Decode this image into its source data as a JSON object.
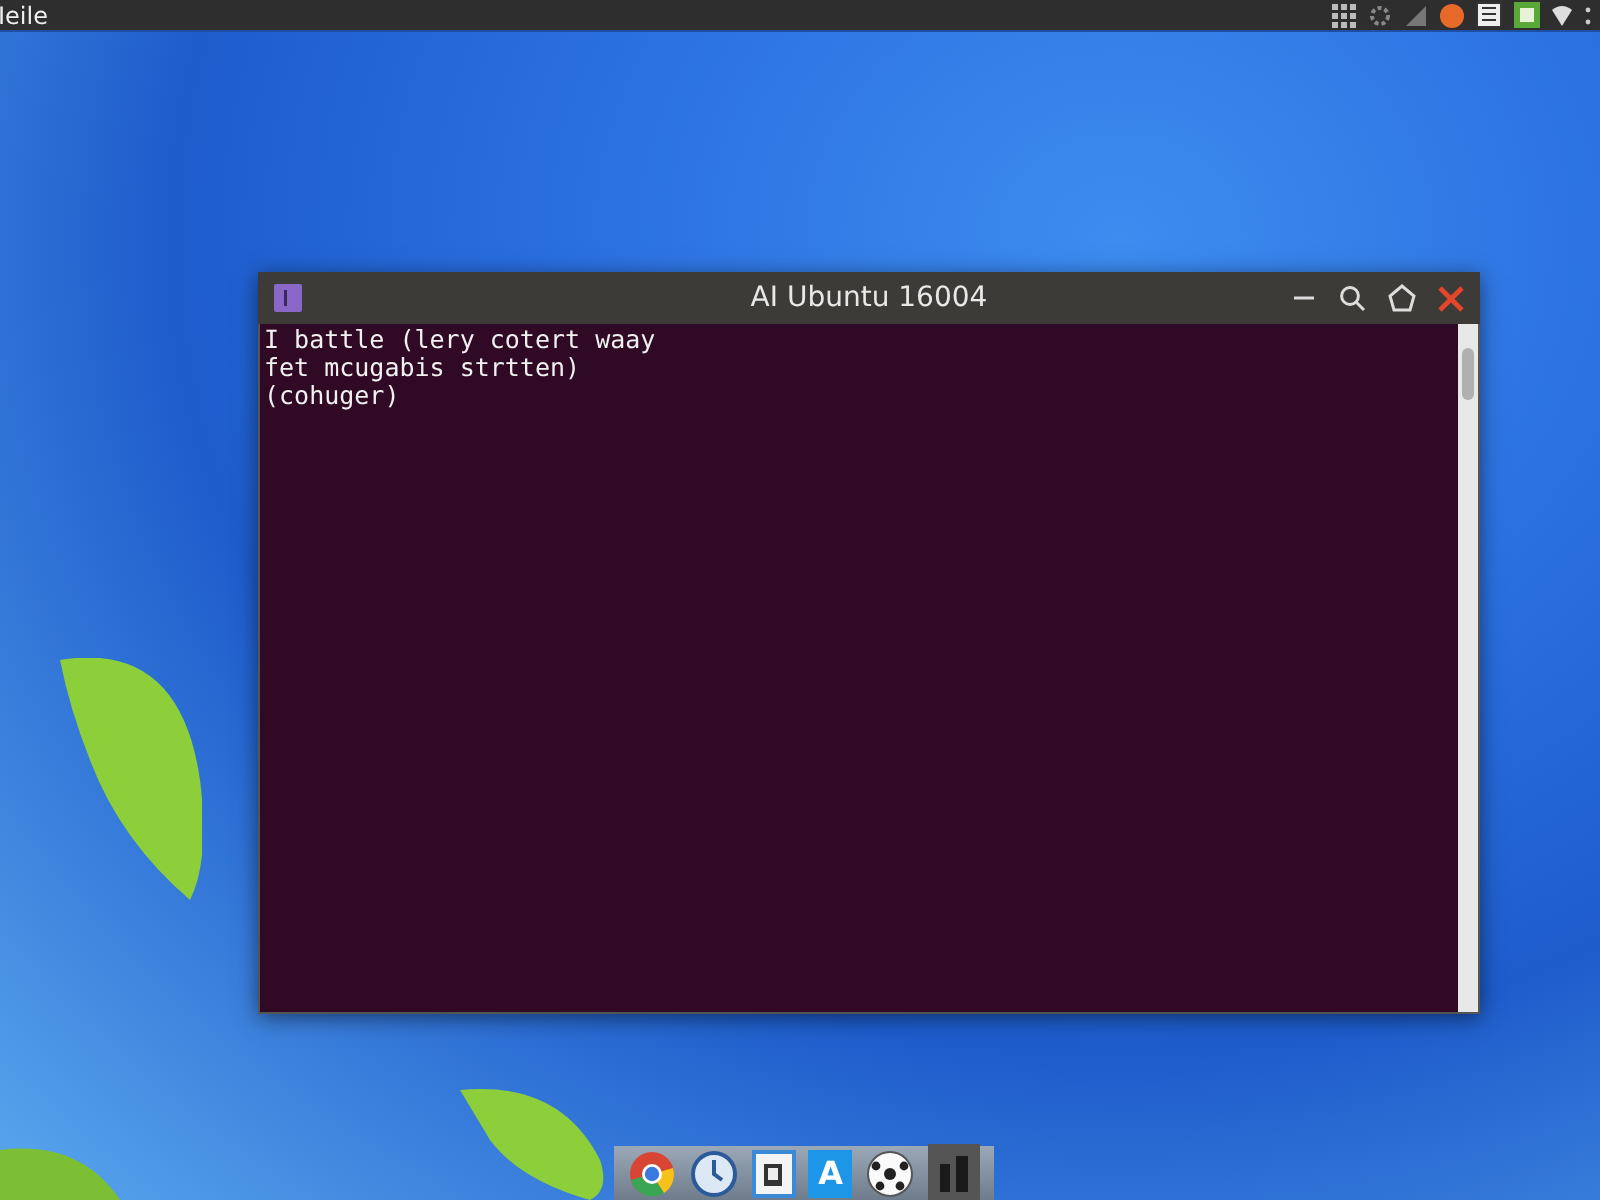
{
  "top_bar": {
    "title": "Ieile"
  },
  "terminal": {
    "title": "AI Ubuntu 16004",
    "lines": [
      "I battle (lery cotert waay",
      "fet mcugabis strtten)",
      "(cohuger)"
    ]
  },
  "dock": {
    "items": [
      {
        "kind": "browser"
      },
      {
        "kind": "clock"
      },
      {
        "kind": "document"
      },
      {
        "kind": "letter",
        "label": "A"
      },
      {
        "kind": "ball"
      },
      {
        "kind": "dark"
      }
    ]
  }
}
